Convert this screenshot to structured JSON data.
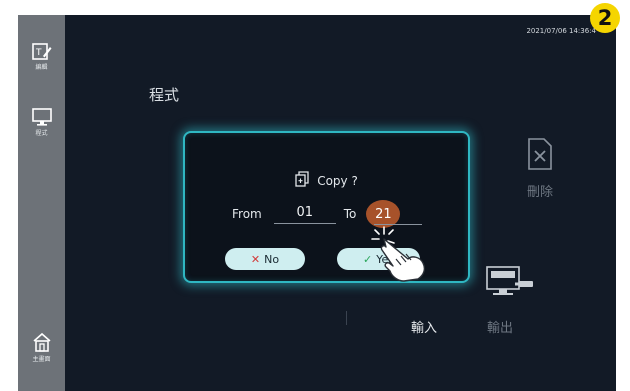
{
  "sidebar": {
    "items": [
      {
        "label": "編輯",
        "icon": "edit-icon"
      },
      {
        "label": "程式",
        "icon": "monitor-icon"
      },
      {
        "label": "主畫面",
        "icon": "home-icon"
      }
    ]
  },
  "header": {
    "timestamp": "2021/07/06 14:36:4"
  },
  "step_badge": "2",
  "page": {
    "title": "程式"
  },
  "actions": {
    "delete_label": "刪除",
    "import_label": "輸入",
    "export_label": "輸出"
  },
  "dialog": {
    "title": "Copy ?",
    "from_label": "From",
    "from_value": "01",
    "to_label": "To",
    "to_value": "21",
    "no_label": "No",
    "yes_label": "Yes"
  },
  "colors": {
    "accent": "#2fb7c2",
    "badge": "#f5d500",
    "to_highlight": "#a7522a"
  }
}
